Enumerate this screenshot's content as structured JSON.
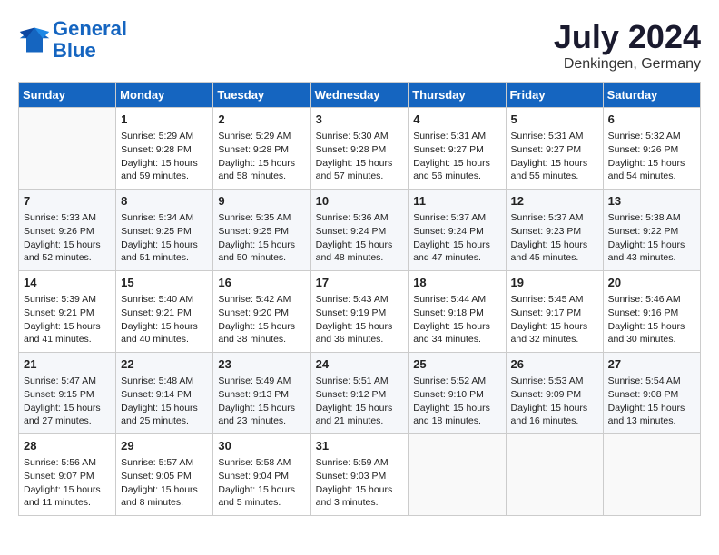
{
  "header": {
    "logo_line1": "General",
    "logo_line2": "Blue",
    "month": "July 2024",
    "location": "Denkingen, Germany"
  },
  "weekdays": [
    "Sunday",
    "Monday",
    "Tuesday",
    "Wednesday",
    "Thursday",
    "Friday",
    "Saturday"
  ],
  "weeks": [
    [
      {
        "day": "",
        "info": ""
      },
      {
        "day": "1",
        "info": "Sunrise: 5:29 AM\nSunset: 9:28 PM\nDaylight: 15 hours\nand 59 minutes."
      },
      {
        "day": "2",
        "info": "Sunrise: 5:29 AM\nSunset: 9:28 PM\nDaylight: 15 hours\nand 58 minutes."
      },
      {
        "day": "3",
        "info": "Sunrise: 5:30 AM\nSunset: 9:28 PM\nDaylight: 15 hours\nand 57 minutes."
      },
      {
        "day": "4",
        "info": "Sunrise: 5:31 AM\nSunset: 9:27 PM\nDaylight: 15 hours\nand 56 minutes."
      },
      {
        "day": "5",
        "info": "Sunrise: 5:31 AM\nSunset: 9:27 PM\nDaylight: 15 hours\nand 55 minutes."
      },
      {
        "day": "6",
        "info": "Sunrise: 5:32 AM\nSunset: 9:26 PM\nDaylight: 15 hours\nand 54 minutes."
      }
    ],
    [
      {
        "day": "7",
        "info": "Sunrise: 5:33 AM\nSunset: 9:26 PM\nDaylight: 15 hours\nand 52 minutes."
      },
      {
        "day": "8",
        "info": "Sunrise: 5:34 AM\nSunset: 9:25 PM\nDaylight: 15 hours\nand 51 minutes."
      },
      {
        "day": "9",
        "info": "Sunrise: 5:35 AM\nSunset: 9:25 PM\nDaylight: 15 hours\nand 50 minutes."
      },
      {
        "day": "10",
        "info": "Sunrise: 5:36 AM\nSunset: 9:24 PM\nDaylight: 15 hours\nand 48 minutes."
      },
      {
        "day": "11",
        "info": "Sunrise: 5:37 AM\nSunset: 9:24 PM\nDaylight: 15 hours\nand 47 minutes."
      },
      {
        "day": "12",
        "info": "Sunrise: 5:37 AM\nSunset: 9:23 PM\nDaylight: 15 hours\nand 45 minutes."
      },
      {
        "day": "13",
        "info": "Sunrise: 5:38 AM\nSunset: 9:22 PM\nDaylight: 15 hours\nand 43 minutes."
      }
    ],
    [
      {
        "day": "14",
        "info": "Sunrise: 5:39 AM\nSunset: 9:21 PM\nDaylight: 15 hours\nand 41 minutes."
      },
      {
        "day": "15",
        "info": "Sunrise: 5:40 AM\nSunset: 9:21 PM\nDaylight: 15 hours\nand 40 minutes."
      },
      {
        "day": "16",
        "info": "Sunrise: 5:42 AM\nSunset: 9:20 PM\nDaylight: 15 hours\nand 38 minutes."
      },
      {
        "day": "17",
        "info": "Sunrise: 5:43 AM\nSunset: 9:19 PM\nDaylight: 15 hours\nand 36 minutes."
      },
      {
        "day": "18",
        "info": "Sunrise: 5:44 AM\nSunset: 9:18 PM\nDaylight: 15 hours\nand 34 minutes."
      },
      {
        "day": "19",
        "info": "Sunrise: 5:45 AM\nSunset: 9:17 PM\nDaylight: 15 hours\nand 32 minutes."
      },
      {
        "day": "20",
        "info": "Sunrise: 5:46 AM\nSunset: 9:16 PM\nDaylight: 15 hours\nand 30 minutes."
      }
    ],
    [
      {
        "day": "21",
        "info": "Sunrise: 5:47 AM\nSunset: 9:15 PM\nDaylight: 15 hours\nand 27 minutes."
      },
      {
        "day": "22",
        "info": "Sunrise: 5:48 AM\nSunset: 9:14 PM\nDaylight: 15 hours\nand 25 minutes."
      },
      {
        "day": "23",
        "info": "Sunrise: 5:49 AM\nSunset: 9:13 PM\nDaylight: 15 hours\nand 23 minutes."
      },
      {
        "day": "24",
        "info": "Sunrise: 5:51 AM\nSunset: 9:12 PM\nDaylight: 15 hours\nand 21 minutes."
      },
      {
        "day": "25",
        "info": "Sunrise: 5:52 AM\nSunset: 9:10 PM\nDaylight: 15 hours\nand 18 minutes."
      },
      {
        "day": "26",
        "info": "Sunrise: 5:53 AM\nSunset: 9:09 PM\nDaylight: 15 hours\nand 16 minutes."
      },
      {
        "day": "27",
        "info": "Sunrise: 5:54 AM\nSunset: 9:08 PM\nDaylight: 15 hours\nand 13 minutes."
      }
    ],
    [
      {
        "day": "28",
        "info": "Sunrise: 5:56 AM\nSunset: 9:07 PM\nDaylight: 15 hours\nand 11 minutes."
      },
      {
        "day": "29",
        "info": "Sunrise: 5:57 AM\nSunset: 9:05 PM\nDaylight: 15 hours\nand 8 minutes."
      },
      {
        "day": "30",
        "info": "Sunrise: 5:58 AM\nSunset: 9:04 PM\nDaylight: 15 hours\nand 5 minutes."
      },
      {
        "day": "31",
        "info": "Sunrise: 5:59 AM\nSunset: 9:03 PM\nDaylight: 15 hours\nand 3 minutes."
      },
      {
        "day": "",
        "info": ""
      },
      {
        "day": "",
        "info": ""
      },
      {
        "day": "",
        "info": ""
      }
    ]
  ]
}
